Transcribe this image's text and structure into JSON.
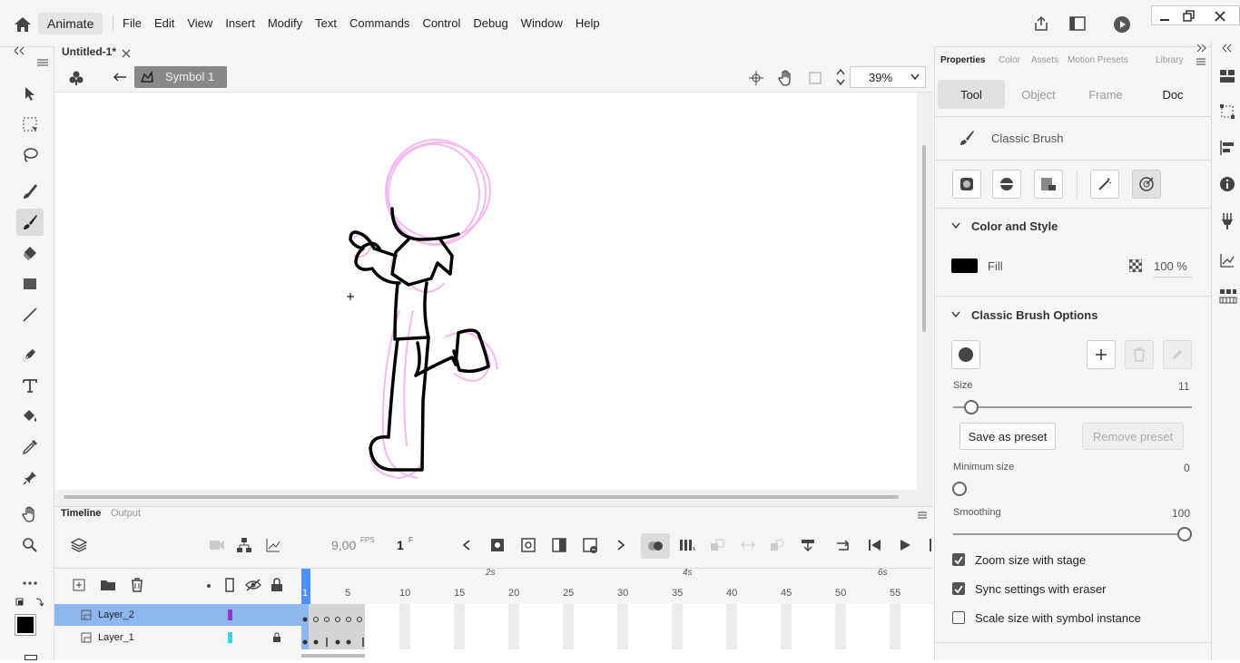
{
  "app": {
    "name": "Animate",
    "document_tab": "Untitled-1*"
  },
  "menu": [
    "File",
    "Edit",
    "View",
    "Insert",
    "Modify",
    "Text",
    "Commands",
    "Control",
    "Debug",
    "Window",
    "Help"
  ],
  "editbar": {
    "symbol_name": "Symbol 1",
    "zoom": "39%"
  },
  "timeline": {
    "tabs": [
      "Timeline",
      "Output"
    ],
    "fps": "9,00",
    "fps_unit": "FPS",
    "frame": "1",
    "frame_unit": "F",
    "seconds": [
      "2s",
      "4s",
      "6s"
    ],
    "ticks": [
      "1",
      "5",
      "10",
      "15",
      "20",
      "25",
      "30",
      "35",
      "40",
      "45",
      "50",
      "55"
    ],
    "layers": [
      {
        "name": "Layer_2",
        "color": "#9b30d0"
      },
      {
        "name": "Layer_1",
        "color": "#1fe0e8"
      }
    ]
  },
  "properties": {
    "tabs": [
      "Properties",
      "Color",
      "Assets",
      "Motion Presets",
      "Library"
    ],
    "seg": [
      "Tool",
      "Object",
      "Frame",
      "Doc"
    ],
    "tool_name": "Classic Brush",
    "color_style": {
      "heading": "Color and Style",
      "fill_label": "Fill",
      "fill_color": "#000000",
      "alpha": "100 %"
    },
    "brush_options": {
      "heading": "Classic Brush Options",
      "size_label": "Size",
      "size": "11",
      "size_pct": 0.01,
      "save": "Save as preset",
      "remove": "Remove preset",
      "min_label": "Minimum size",
      "min": "0",
      "smooth_label": "Smoothing",
      "smooth": "100"
    },
    "checks": [
      {
        "label": "Zoom size with stage",
        "on": true
      },
      {
        "label": "Sync settings with eraser",
        "on": true
      },
      {
        "label": "Scale size with symbol instance",
        "on": false
      }
    ]
  }
}
